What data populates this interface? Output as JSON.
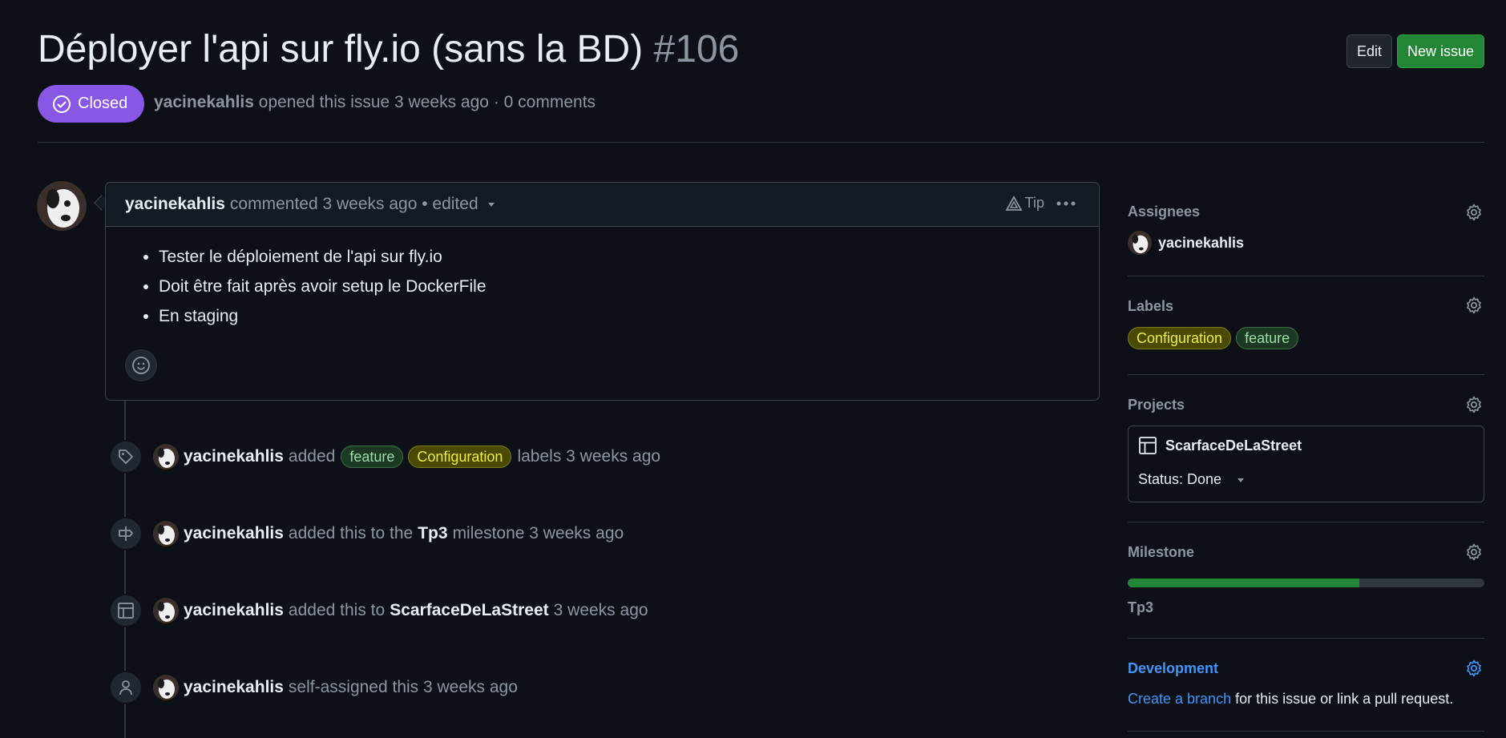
{
  "issue": {
    "title": "Déployer l'api sur fly.io (sans la BD)",
    "number": "#106",
    "state": "Closed",
    "author": "yacinekahlis",
    "opened_text": "opened this issue 3 weeks ago",
    "sep": "·",
    "comments_count": "0 comments"
  },
  "header_buttons": {
    "edit": "Edit",
    "new_issue": "New issue"
  },
  "comment": {
    "author": "yacinekahlis",
    "action": "commented 3 weeks ago • edited",
    "tip": "Tip",
    "items": [
      "Tester le déploiement de l'api sur fly.io",
      "Doit être fait après avoir setup le DockerFile",
      "En staging"
    ]
  },
  "timeline": [
    {
      "icon": "tag-icon",
      "user": "yacinekahlis",
      "pre": "added",
      "labels": [
        "feature",
        "Configuration"
      ],
      "post": "labels 3 weeks ago"
    },
    {
      "icon": "milestone-icon",
      "user": "yacinekahlis",
      "pre": "added this to the",
      "strong": "Tp3",
      "post": "milestone 3 weeks ago"
    },
    {
      "icon": "project-icon",
      "user": "yacinekahlis",
      "pre": "added this to",
      "strong": "ScarfaceDeLaStreet",
      "post": "3 weeks ago"
    },
    {
      "icon": "person-icon",
      "user": "yacinekahlis",
      "pre": "self-assigned this 3 weeks ago"
    }
  ],
  "sidebar": {
    "assignees": {
      "heading": "Assignees",
      "user": "yacinekahlis"
    },
    "labels": {
      "heading": "Labels",
      "items": [
        "Configuration",
        "feature"
      ]
    },
    "projects": {
      "heading": "Projects",
      "name": "ScarfaceDeLaStreet",
      "status": "Status: Done"
    },
    "milestone": {
      "heading": "Milestone",
      "name": "Tp3",
      "progress": 0.65
    },
    "development": {
      "heading": "Development",
      "link": "Create a branch",
      "rest": "for this issue or link a pull request."
    }
  },
  "colors": {
    "background": "#0d1117",
    "closed_purple": "#8957e5",
    "green": "#238636",
    "link_blue": "#4493f8",
    "label_feature": "#1c3a23",
    "label_configuration": "#4a4a05"
  }
}
